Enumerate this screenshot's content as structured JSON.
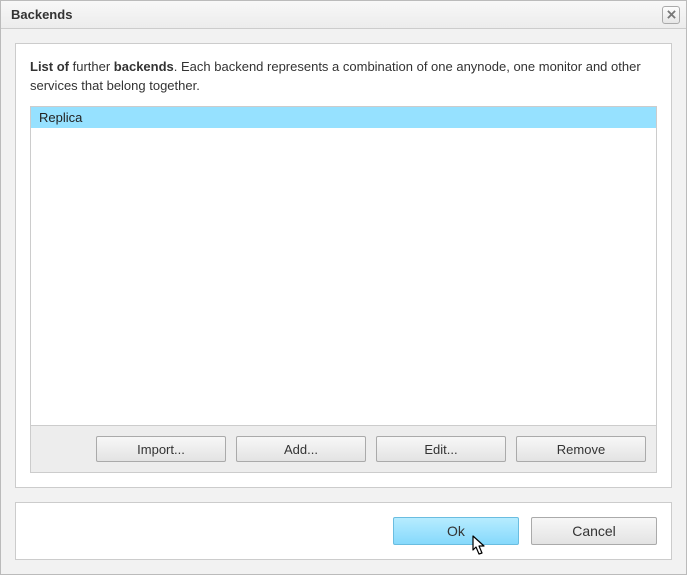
{
  "dialog": {
    "title": "Backends"
  },
  "description": {
    "part1_bold": "List of",
    "part2": " further ",
    "part3_bold": "backends",
    "part4": ". Each backend represents a combination of one anynode, one monitor and other services that belong together."
  },
  "list": {
    "items": [
      "Replica"
    ],
    "selectedIndex": 0
  },
  "actions": {
    "import": "Import...",
    "add": "Add...",
    "edit": "Edit...",
    "remove": "Remove"
  },
  "footer": {
    "ok": "Ok",
    "cancel": "Cancel"
  }
}
